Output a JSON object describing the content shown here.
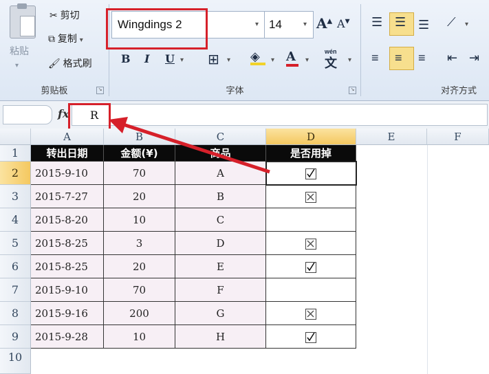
{
  "ribbon": {
    "clipboard": {
      "paste": "粘贴",
      "cut": "剪切",
      "copy": "复制",
      "format_painter": "格式刷",
      "group_label": "剪贴板"
    },
    "font": {
      "font_name": "Wingdings 2",
      "font_size": "14",
      "bold": "B",
      "italic": "I",
      "underline": "U",
      "grow": "A",
      "shrink": "A",
      "font_color": "A",
      "phonetic": "wén",
      "phonetic_char": "文",
      "group_label": "字体"
    },
    "alignment": {
      "group_label": "对齐方式"
    }
  },
  "formula_bar": {
    "fx": "fx",
    "content": "R"
  },
  "columns": [
    "A",
    "B",
    "C",
    "D",
    "E",
    "F"
  ],
  "rows": [
    "1",
    "2",
    "3",
    "4",
    "5",
    "6",
    "7",
    "8",
    "9",
    "10"
  ],
  "table": {
    "headers": [
      "转出日期",
      "金额(¥)",
      "商品",
      "是否用掉"
    ],
    "rows": [
      {
        "date": "2015-9-10",
        "amount": "70",
        "item": "A",
        "used": "check"
      },
      {
        "date": "2015-7-27",
        "amount": "20",
        "item": "B",
        "used": "cross"
      },
      {
        "date": "2015-8-20",
        "amount": "10",
        "item": "C",
        "used": ""
      },
      {
        "date": "2015-8-25",
        "amount": "3",
        "item": "D",
        "used": "cross"
      },
      {
        "date": "2015-8-25",
        "amount": "20",
        "item": "E",
        "used": "check"
      },
      {
        "date": "2015-9-10",
        "amount": "70",
        "item": "F",
        "used": ""
      },
      {
        "date": "2015-9-16",
        "amount": "200",
        "item": "G",
        "used": "cross"
      },
      {
        "date": "2015-9-28",
        "amount": "10",
        "item": "H",
        "used": "check"
      }
    ]
  },
  "colors": {
    "highlight": "#d6202a",
    "header_bg": "#0a0a0a",
    "selected_header": "#f4c860"
  }
}
